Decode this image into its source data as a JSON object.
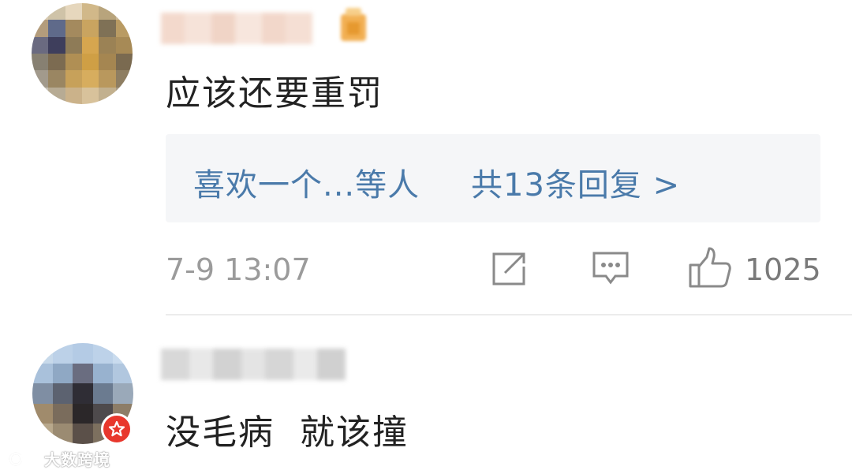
{
  "comments": [
    {
      "username": "",
      "text": "应该还要重罚",
      "reply_preview": {
        "likers": "喜欢一个...等人",
        "count_label": "共13条回复 >"
      },
      "timestamp": "7-9 13:07",
      "like_count": "1025"
    },
    {
      "username": "",
      "text": "没毛病  就该撞"
    }
  ],
  "icons": {
    "forward": "forward-icon",
    "reply": "comment-icon",
    "like": "thumbs-up-icon",
    "verified_badge": "star-badge-icon",
    "watermark_logo": "weibo-logo-icon"
  },
  "colors": {
    "link_blue": "#4a7aaa",
    "text_dark": "#222222",
    "text_gray": "#9b9b9b",
    "reply_bg": "#f5f6f8",
    "badge_red": "#e8372c"
  },
  "watermark": {
    "text": "大数跨境"
  }
}
